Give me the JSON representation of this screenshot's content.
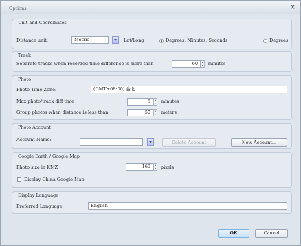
{
  "window": {
    "title": "Options",
    "close_glyph": "×"
  },
  "unit_coordinates": {
    "group_label": "Unit and Coordinates",
    "distance_unit_label": "Distance unit:",
    "distance_unit_value": "Metric",
    "lat_long_label": "Lat/Long",
    "options": [
      {
        "label": "Degrees, Minutes, Seconds",
        "selected": true
      },
      {
        "label": "Degrees",
        "selected": false
      }
    ]
  },
  "track": {
    "group_label": "Track",
    "separate_label": "Separate tracks when recorded time difference is more than",
    "separate_value": "60",
    "separate_unit": "minutes"
  },
  "photo": {
    "group_label": "Photo",
    "time_zone_label": "Photo Time Zone:",
    "time_zone_value": "(GMT+08:00) 台北",
    "max_diff_label": "Max photo/track diff time",
    "max_diff_value": "5",
    "max_diff_unit": "minutes",
    "group_when_label": "Group photos when distance is less than",
    "group_when_value": "50",
    "group_when_unit": "meters"
  },
  "photo_account": {
    "group_label": "Photo Account",
    "account_name_label": "Account Name:",
    "account_name_value": "",
    "delete_label": "Delete Account",
    "new_label": "New Account..."
  },
  "google": {
    "group_label": "Google Earth / Google Map",
    "photo_size_label": "Photo size in KMZ",
    "photo_size_value": "160",
    "photo_size_unit": "pixels",
    "display_china_label": "Display China Google Map",
    "display_china_checked": false
  },
  "display_language": {
    "group_label": "Display Language",
    "preferred_label": "Preferred Language:",
    "preferred_value": "English"
  },
  "footer": {
    "ok_label": "OK",
    "cancel_label": "Cancel"
  }
}
